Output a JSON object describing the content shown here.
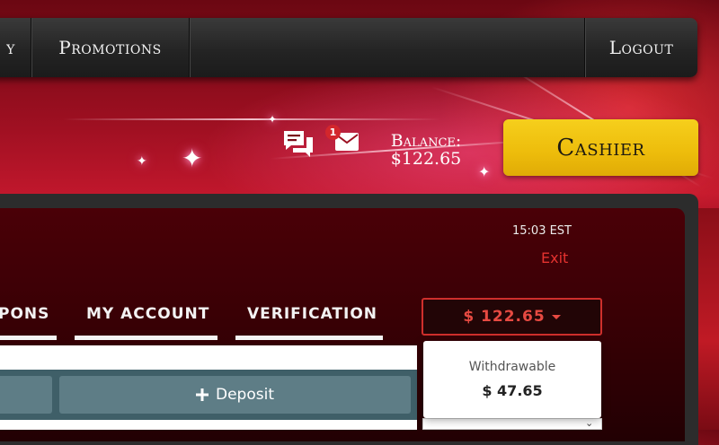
{
  "nav": {
    "items": [
      "y",
      "Promotions",
      "Logout"
    ]
  },
  "header": {
    "notification_count": "1",
    "balance_label": "Balance:",
    "balance_value": "$122.65",
    "cashier_label": "Cashier",
    "icons": [
      "chat-icon",
      "mail-icon"
    ]
  },
  "panel": {
    "time": "15:03 EST",
    "exit_label": "Exit",
    "tabs": [
      "PONS",
      "MY ACCOUNT",
      "VERIFICATION"
    ],
    "balance_button": "$ 122.65",
    "deposit_label": "Deposit"
  },
  "dropdown": {
    "label": "Withdrawable",
    "value": "$ 47.65"
  },
  "colors": {
    "accent_red": "#cf2f2c",
    "cashier_yellow": "#f0c010",
    "nav_dark": "#242424",
    "button_slate": "#5e7d86"
  }
}
